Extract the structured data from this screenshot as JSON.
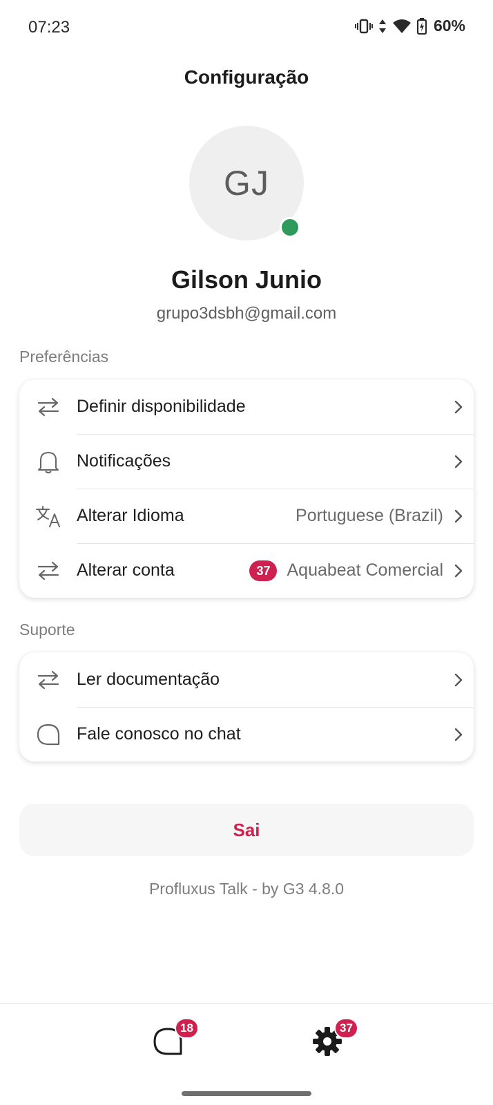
{
  "status_bar": {
    "time": "07:23",
    "battery": "60%",
    "icons": [
      "vibrate-icon",
      "data-arrows-icon",
      "wifi-icon",
      "battery-charging-icon"
    ]
  },
  "header": {
    "title": "Configuração"
  },
  "profile": {
    "initials": "GJ",
    "name": "Gilson Junio",
    "email": "grupo3dsbh@gmail.com",
    "online_color": "#2e9a5c"
  },
  "preferences": {
    "label": "Preferências",
    "items": [
      {
        "label": "Definir disponibilidade",
        "icon": "swap-arrows-icon",
        "value": "",
        "badge": ""
      },
      {
        "label": "Notificações",
        "icon": "bell-icon",
        "value": "",
        "badge": ""
      },
      {
        "label": "Alterar Idioma",
        "icon": "translate-icon",
        "value": "Portuguese (Brazil)",
        "badge": ""
      },
      {
        "label": "Alterar conta",
        "icon": "swap-arrows-icon",
        "value": "Aquabeat Comercial",
        "badge": "37"
      }
    ]
  },
  "support": {
    "label": "Suporte",
    "items": [
      {
        "label": "Ler documentação",
        "icon": "swap-arrows-icon"
      },
      {
        "label": "Fale conosco no chat",
        "icon": "chat-bubble-icon"
      }
    ]
  },
  "logout": {
    "label": "Sai"
  },
  "footer": {
    "version": "Profluxus Talk - by G3 4.8.0"
  },
  "bottom_nav": {
    "items": [
      {
        "name": "conversations",
        "icon": "chat-bubble-icon",
        "badge": "18"
      },
      {
        "name": "settings",
        "icon": "gear-icon",
        "badge": "37"
      }
    ]
  },
  "colors": {
    "accent": "#cf2150",
    "online": "#2e9a5c"
  }
}
